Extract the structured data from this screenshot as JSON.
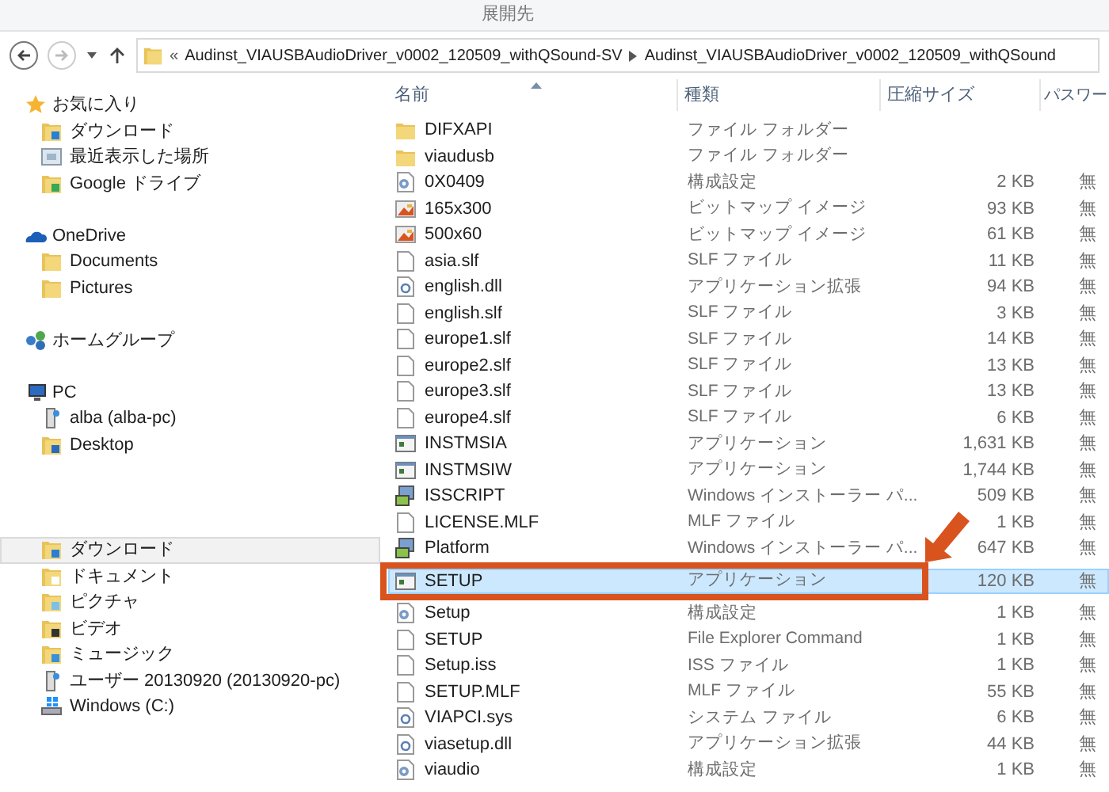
{
  "ribbon": {
    "tab": "展開先"
  },
  "address_bar": {
    "overflow": "«",
    "segments": [
      "Audinst_VIAUSBAudioDriver_v0002_120509_withQSound-SV",
      "Audinst_VIAUSBAudioDriver_v0002_120509_withQSound"
    ]
  },
  "sidebar": {
    "sections": [
      {
        "label": "お気に入り",
        "kind": "favorites",
        "items": [
          {
            "label": "ダウンロード",
            "kind": "download",
            "selected": false
          },
          {
            "label": "最近表示した場所",
            "kind": "recent",
            "selected": false
          },
          {
            "label": "Google ドライブ",
            "kind": "gdrive",
            "selected": false
          }
        ]
      },
      {
        "label": "OneDrive",
        "kind": "cloud",
        "items": [
          {
            "label": "Documents",
            "kind": "folder",
            "selected": false
          },
          {
            "label": "Pictures",
            "kind": "folder",
            "selected": false
          }
        ]
      },
      {
        "label": "ホームグループ",
        "kind": "homegroup"
      },
      {
        "label": "PC",
        "kind": "pc",
        "items": [
          {
            "label": "alba (alba-pc)",
            "kind": "network",
            "selected": false
          },
          {
            "label": "Desktop",
            "kind": "desktop",
            "selected": false
          }
        ]
      },
      {
        "items": [
          {
            "label": "ダウンロード",
            "kind": "download",
            "selected": true
          },
          {
            "label": "ドキュメント",
            "kind": "documents",
            "selected": false
          },
          {
            "label": "ピクチャ",
            "kind": "pictures",
            "selected": false
          },
          {
            "label": "ビデオ",
            "kind": "videos",
            "selected": false
          },
          {
            "label": "ミュージック",
            "kind": "music",
            "selected": false
          },
          {
            "label": "ユーザー 20130920 (20130920-pc)",
            "kind": "network",
            "selected": false
          },
          {
            "label": "Windows (C:)",
            "kind": "drive",
            "selected": false
          }
        ]
      }
    ]
  },
  "table": {
    "columns": [
      "名前",
      "種類",
      "圧縮サイズ",
      "パスワー"
    ],
    "rows": [
      {
        "name": "DIFXAPI",
        "type": "ファイル フォルダー",
        "kind": "folder",
        "selected": false
      },
      {
        "name": "viaudusb",
        "type": "ファイル フォルダー",
        "kind": "folder",
        "selected": false
      },
      {
        "name": "0X0409",
        "type": "構成設定",
        "size": "2 KB",
        "password": "無",
        "kind": "config",
        "selected": false
      },
      {
        "name": "165x300",
        "type": "ビットマップ イメージ",
        "size": "93 KB",
        "password": "無",
        "kind": "bitmap",
        "selected": false
      },
      {
        "name": "500x60",
        "type": "ビットマップ イメージ",
        "size": "61 KB",
        "password": "無",
        "kind": "bitmap",
        "selected": false
      },
      {
        "name": "asia.slf",
        "type": "SLF ファイル",
        "size": "11 KB",
        "password": "無",
        "kind": "document",
        "selected": false
      },
      {
        "name": "english.dll",
        "type": "アプリケーション拡張",
        "size": "94 KB",
        "password": "無",
        "kind": "extension",
        "selected": false
      },
      {
        "name": "english.slf",
        "type": "SLF ファイル",
        "size": "3 KB",
        "password": "無",
        "kind": "document",
        "selected": false
      },
      {
        "name": "europe1.slf",
        "type": "SLF ファイル",
        "size": "14 KB",
        "password": "無",
        "kind": "document",
        "selected": false
      },
      {
        "name": "europe2.slf",
        "type": "SLF ファイル",
        "size": "13 KB",
        "password": "無",
        "kind": "document",
        "selected": false
      },
      {
        "name": "europe3.slf",
        "type": "SLF ファイル",
        "size": "13 KB",
        "password": "無",
        "kind": "document",
        "selected": false
      },
      {
        "name": "europe4.slf",
        "type": "SLF ファイル",
        "size": "6 KB",
        "password": "無",
        "kind": "document",
        "selected": false
      },
      {
        "name": "INSTMSIA",
        "type": "アプリケーション",
        "size": "1,631 KB",
        "password": "無",
        "kind": "application",
        "selected": false
      },
      {
        "name": "INSTMSIW",
        "type": "アプリケーション",
        "size": "1,744 KB",
        "password": "無",
        "kind": "application",
        "selected": false
      },
      {
        "name": "ISSCRIPT",
        "type": "Windows インストーラー パ...",
        "size": "509 KB",
        "password": "無",
        "kind": "installer",
        "selected": false
      },
      {
        "name": "LICENSE.MLF",
        "type": "MLF ファイル",
        "size": "1 KB",
        "password": "無",
        "kind": "document",
        "selected": false
      },
      {
        "name": "Platform",
        "type": "Windows インストーラー パ...",
        "size": "647 KB",
        "password": "無",
        "kind": "installer",
        "selected": false
      },
      {
        "name": "SETUP",
        "type": "アプリケーション",
        "size": "120 KB",
        "password": "無",
        "kind": "application",
        "selected": true
      },
      {
        "name": "Setup",
        "type": "構成設定",
        "size": "1 KB",
        "password": "無",
        "kind": "config",
        "selected": false
      },
      {
        "name": "SETUP",
        "type": "File Explorer Command",
        "size": "1 KB",
        "password": "無",
        "kind": "document",
        "selected": false
      },
      {
        "name": "Setup.iss",
        "type": "ISS ファイル",
        "size": "1 KB",
        "password": "無",
        "kind": "document",
        "selected": false
      },
      {
        "name": "SETUP.MLF",
        "type": "MLF ファイル",
        "size": "55 KB",
        "password": "無",
        "kind": "document",
        "selected": false
      },
      {
        "name": "VIAPCI.sys",
        "type": "システム ファイル",
        "size": "6 KB",
        "password": "無",
        "kind": "extension",
        "selected": false
      },
      {
        "name": "viasetup.dll",
        "type": "アプリケーション拡張",
        "size": "44 KB",
        "password": "無",
        "kind": "extension",
        "selected": false
      },
      {
        "name": "viaudio",
        "type": "構成設定",
        "size": "1 KB",
        "password": "無",
        "kind": "config",
        "selected": false
      }
    ]
  }
}
